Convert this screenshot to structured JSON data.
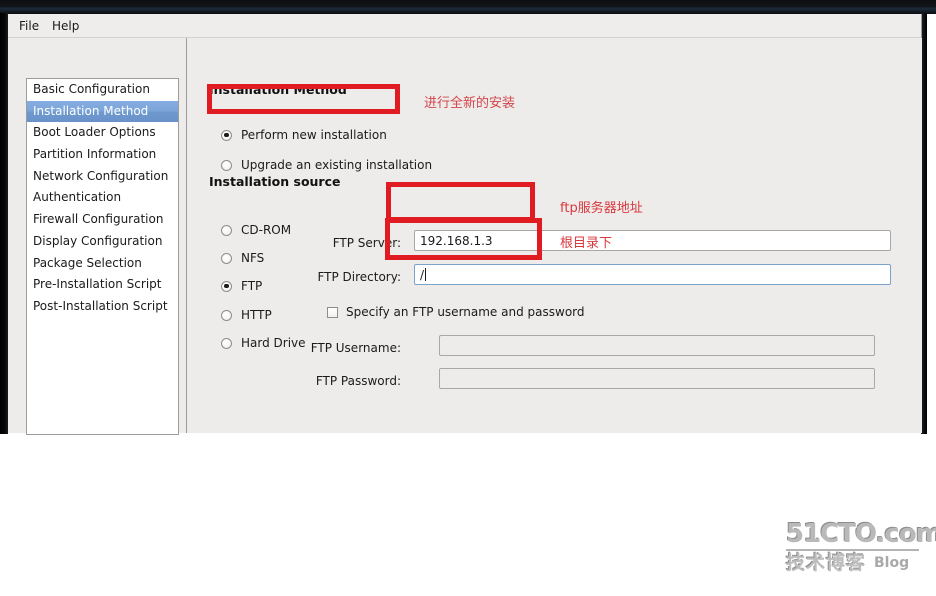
{
  "window": {
    "menubar": {
      "file": "File",
      "help": "Help"
    }
  },
  "sidebar": {
    "items": [
      {
        "label": "Basic Configuration",
        "selected": false
      },
      {
        "label": "Installation Method",
        "selected": true
      },
      {
        "label": "Boot Loader Options",
        "selected": false
      },
      {
        "label": "Partition Information",
        "selected": false
      },
      {
        "label": "Network Configuration",
        "selected": false
      },
      {
        "label": "Authentication",
        "selected": false
      },
      {
        "label": "Firewall Configuration",
        "selected": false
      },
      {
        "label": "Display Configuration",
        "selected": false
      },
      {
        "label": "Package Selection",
        "selected": false
      },
      {
        "label": "Pre-Installation Script",
        "selected": false
      },
      {
        "label": "Post-Installation Script",
        "selected": false
      }
    ]
  },
  "main": {
    "installation_method": {
      "title": "Installation Method",
      "options": [
        {
          "label": "Perform new installation",
          "selected": true
        },
        {
          "label": "Upgrade an existing installation",
          "selected": false
        }
      ]
    },
    "installation_source": {
      "title": "Installation source",
      "options": [
        {
          "label": "CD-ROM",
          "selected": false
        },
        {
          "label": "NFS",
          "selected": false
        },
        {
          "label": "FTP",
          "selected": true
        },
        {
          "label": "HTTP",
          "selected": false
        },
        {
          "label": "Hard Drive",
          "selected": false
        }
      ],
      "fields": {
        "server_label": "FTP Server:",
        "server_value": "192.168.1.3",
        "directory_label": "FTP Directory:",
        "directory_value": "/",
        "specify_checkbox_label": "Specify an FTP username and password",
        "specify_checked": false,
        "username_label": "FTP Username:",
        "username_value": "",
        "password_label": "FTP Password:",
        "password_value": ""
      }
    }
  },
  "annotations": {
    "color": "#d9383d",
    "box_color": "#e01b22",
    "new_install": "进行全新的安装",
    "ftp_server": "ftp服务器地址",
    "ftp_directory": "根目录下"
  },
  "watermark": {
    "top": "51CTO.com",
    "bottom_cn": "技术博客",
    "bottom_en": "Blog"
  }
}
